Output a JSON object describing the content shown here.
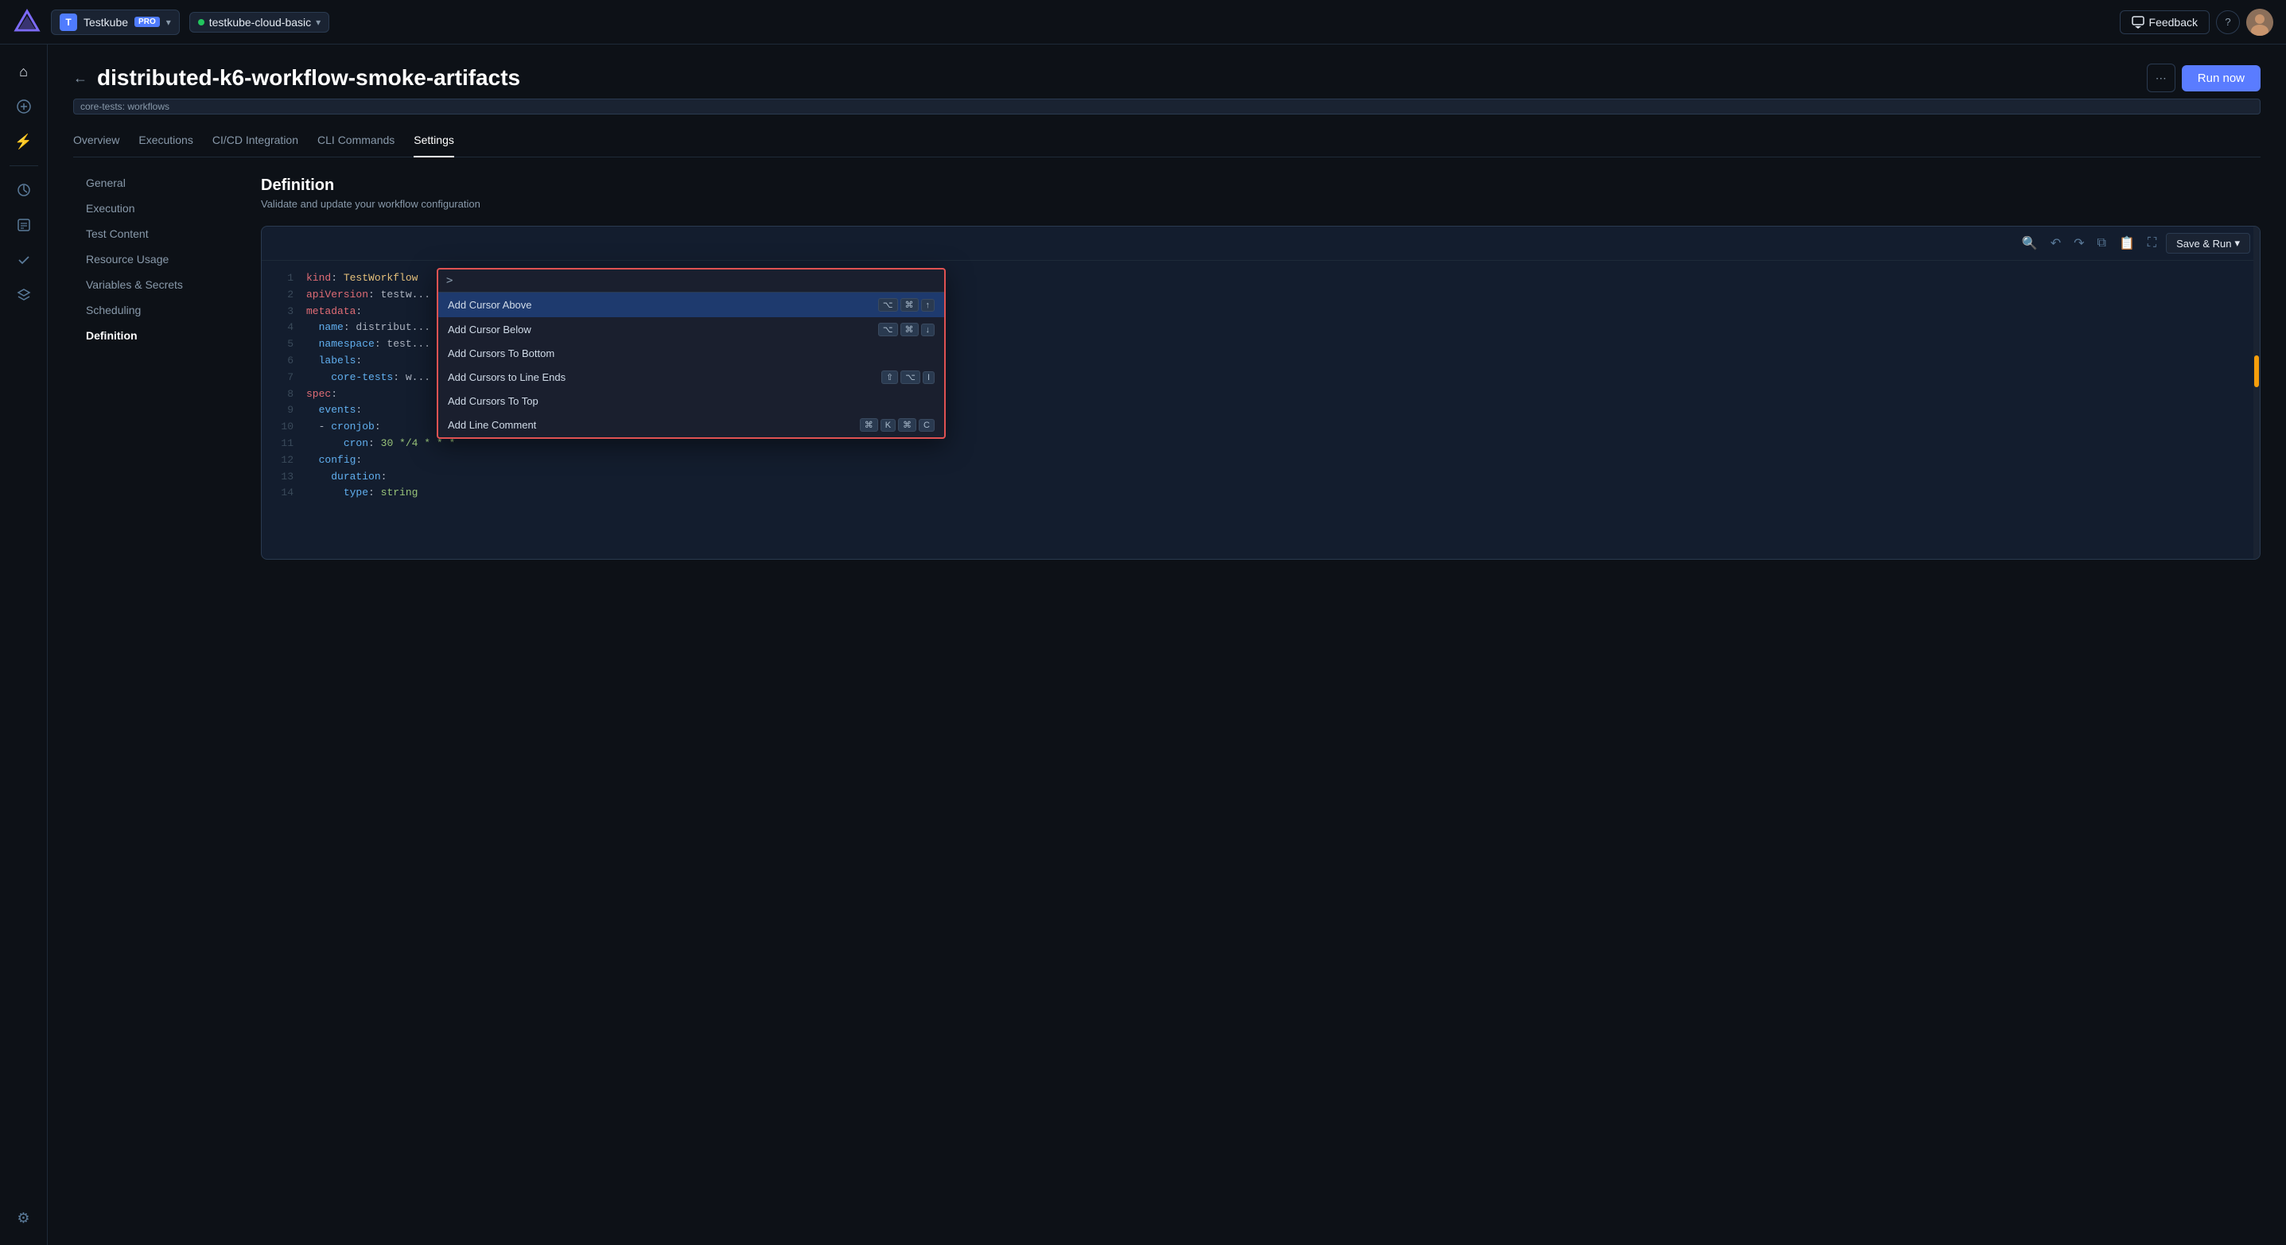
{
  "topnav": {
    "workspace_initial": "T",
    "workspace_name": "Testkube",
    "pro_label": "PRO",
    "env_name": "testkube-cloud-basic",
    "feedback_label": "Feedback",
    "help_label": "?"
  },
  "page": {
    "title": "distributed-k6-workflow-smoke-artifacts",
    "tag": "core-tests: workflows",
    "run_now_label": "Run now",
    "back_label": "←"
  },
  "tabs": [
    {
      "id": "overview",
      "label": "Overview"
    },
    {
      "id": "executions",
      "label": "Executions"
    },
    {
      "id": "cicd",
      "label": "CI/CD Integration"
    },
    {
      "id": "cli",
      "label": "CLI Commands"
    },
    {
      "id": "settings",
      "label": "Settings",
      "active": true
    }
  ],
  "settings_nav": [
    {
      "id": "general",
      "label": "General"
    },
    {
      "id": "execution",
      "label": "Execution"
    },
    {
      "id": "test-content",
      "label": "Test Content"
    },
    {
      "id": "resource-usage",
      "label": "Resource Usage"
    },
    {
      "id": "variables-secrets",
      "label": "Variables & Secrets"
    },
    {
      "id": "scheduling",
      "label": "Scheduling"
    },
    {
      "id": "definition",
      "label": "Definition",
      "active": true
    }
  ],
  "definition": {
    "title": "Definition",
    "subtitle": "Validate and update your workflow configuration",
    "save_run_label": "Save & Run"
  },
  "editor": {
    "lines": [
      {
        "num": 1,
        "content": "kind: TestWorkflow"
      },
      {
        "num": 2,
        "content": "apiVersion: testw..."
      },
      {
        "num": 3,
        "content": "metadata:"
      },
      {
        "num": 4,
        "content": "  name: distribut..."
      },
      {
        "num": 5,
        "content": "  namespace: test..."
      },
      {
        "num": 6,
        "content": "  labels:"
      },
      {
        "num": 7,
        "content": "    core-tests: w..."
      },
      {
        "num": 8,
        "content": "spec:"
      },
      {
        "num": 9,
        "content": "  events:"
      },
      {
        "num": 10,
        "content": "  - cronjob:"
      },
      {
        "num": 11,
        "content": "      cron: 30 */4 * * *"
      },
      {
        "num": 12,
        "content": "  config:"
      },
      {
        "num": 13,
        "content": "    duration:"
      },
      {
        "num": 14,
        "content": "      type: string"
      }
    ]
  },
  "command_palette": {
    "prompt": ">",
    "placeholder": "",
    "items": [
      {
        "id": "add-cursor-above",
        "label": "Add Cursor Above",
        "keys": [
          "⌥",
          "⌘",
          "↑"
        ],
        "selected": true
      },
      {
        "id": "add-cursor-below",
        "label": "Add Cursor Below",
        "keys": [
          "⌥",
          "⌘",
          "↓"
        ]
      },
      {
        "id": "add-cursors-bottom",
        "label": "Add Cursors To Bottom",
        "keys": []
      },
      {
        "id": "add-cursors-line-ends",
        "label": "Add Cursors to Line Ends",
        "keys": [
          "⇧",
          "⌥",
          "I"
        ]
      },
      {
        "id": "add-cursors-top",
        "label": "Add Cursors To Top",
        "keys": []
      },
      {
        "id": "add-line-comment",
        "label": "Add Line Comment",
        "keys": [
          "⌘",
          "K",
          "⌘",
          "C"
        ]
      }
    ]
  },
  "sidebar_icons": [
    {
      "id": "home",
      "symbol": "⌂",
      "label": "home-icon"
    },
    {
      "id": "add-test",
      "symbol": "⊕",
      "label": "add-test-icon"
    },
    {
      "id": "triggers",
      "symbol": "⚡",
      "label": "triggers-icon"
    },
    {
      "id": "analytics",
      "symbol": "◉",
      "label": "analytics-icon"
    },
    {
      "id": "reports",
      "symbol": "▤",
      "label": "reports-icon"
    },
    {
      "id": "checks",
      "symbol": "✓",
      "label": "checks-icon"
    },
    {
      "id": "layers",
      "symbol": "❑",
      "label": "layers-icon"
    }
  ],
  "sidebar_bottom_icons": [
    {
      "id": "settings",
      "symbol": "⚙",
      "label": "settings-icon"
    }
  ]
}
